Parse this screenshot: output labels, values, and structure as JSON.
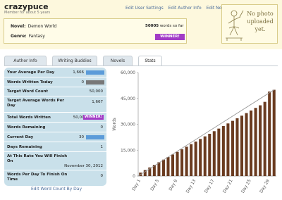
{
  "header": {
    "username": "crazypuce",
    "member_since": "Member for about 5 years",
    "links": [
      "Edit User Settings",
      "Edit Author Info",
      "Edit Novel Info"
    ],
    "novel_label": "Novel:",
    "novel_value": "Demon World",
    "genre_label": "Genre:",
    "genre_value": "Fantasy",
    "word_count": "50005",
    "word_count_suffix": "words so far",
    "winner_badge": "WINNER!",
    "photo_text": "No photo uploaded yet."
  },
  "tabs": [
    {
      "label": "Author Info",
      "active": false
    },
    {
      "label": "Writing Buddies",
      "active": false
    },
    {
      "label": "Novels",
      "active": false
    },
    {
      "label": "Stats",
      "active": true
    }
  ],
  "stats": {
    "average_per_day": {
      "label": "Your Average Per Day",
      "value": "1,666",
      "fill": 1.0
    },
    "written_today": {
      "label": "Words Written Today",
      "value": "0",
      "fill": 1.0
    },
    "target_word_count": {
      "label": "Target Word Count",
      "value": "50,000"
    },
    "target_average": {
      "label": "Target Average Words Per Day",
      "value": "1,667"
    },
    "total_written": {
      "label": "Total Words Written",
      "value": "50,005",
      "badge": "WINNER!"
    },
    "words_remaining": {
      "label": "Words Remaining",
      "value": "0"
    },
    "current_day": {
      "label": "Current Day",
      "value": "30",
      "fill": 1.0
    },
    "days_remaining": {
      "label": "Days Remaining",
      "value": "1"
    },
    "finish_on": {
      "label": "At This Rate You Will Finish On",
      "value": "November 30, 2012"
    },
    "words_per_day_finish": {
      "label": "Words Per Day To Finish On Time",
      "value": "0"
    }
  },
  "edit_link": "Edit Word Count By Day",
  "colors": {
    "header_bg": "#fdf8dd",
    "panel_bg": "#c9e0ea",
    "bar_fill": "#6a3b20",
    "target_line": "#999999",
    "badge": "#a23bc6",
    "link": "#4a6c9b"
  },
  "chart_data": {
    "type": "bar",
    "ylabel": "Words",
    "ylim": [
      0,
      60000
    ],
    "yticks": [
      "0",
      "15,000",
      "30,000",
      "45,000",
      "60,000"
    ],
    "categories": [
      "Day 1",
      "Day 2",
      "Day 3",
      "Day 4",
      "Day 5",
      "Day 6",
      "Day 7",
      "Day 8",
      "Day 9",
      "Day 10",
      "Day 11",
      "Day 12",
      "Day 13",
      "Day 14",
      "Day 15",
      "Day 16",
      "Day 17",
      "Day 18",
      "Day 19",
      "Day 20",
      "Day 21",
      "Day 22",
      "Day 23",
      "Day 24",
      "Day 25",
      "Day 26",
      "Day 27",
      "Day 28",
      "Day 29",
      "Day 30"
    ],
    "xtick_labels": [
      "Day 1",
      "Day 5",
      "Day 9",
      "Day 13",
      "Day 17",
      "Day 21",
      "Day 25",
      "Day 29"
    ],
    "series": [
      {
        "values": [
          2000,
          3500,
          5000,
          6500,
          8000,
          9500,
          11000,
          12500,
          14000,
          15500,
          17000,
          18500,
          20000,
          21500,
          23000,
          24500,
          26000,
          27500,
          29000,
          30500,
          32000,
          33500,
          35000,
          36500,
          38000,
          39500,
          41000,
          43000,
          49000,
          50005
        ]
      }
    ],
    "target_line": [
      0,
      50000
    ],
    "grid": false
  }
}
